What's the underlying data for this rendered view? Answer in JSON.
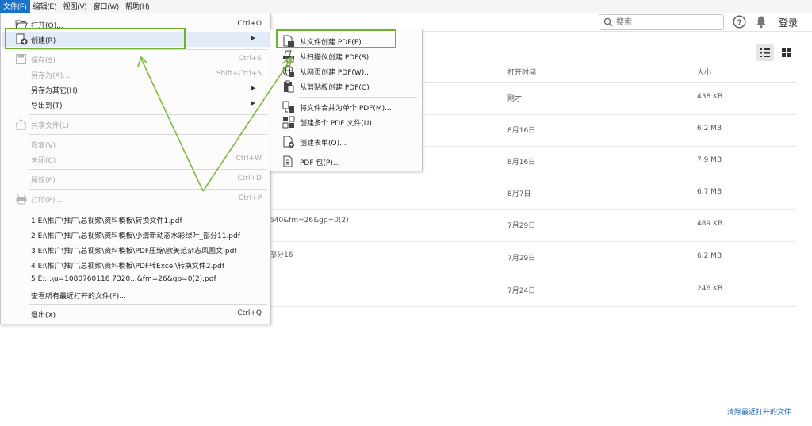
{
  "menubar": [
    {
      "label": "文件(F)",
      "active": true
    },
    {
      "label": "编辑(E)"
    },
    {
      "label": "视图(V)"
    },
    {
      "label": "窗口(W)"
    },
    {
      "label": "帮助(H)"
    }
  ],
  "toolbar": {
    "search_placeholder": "搜索",
    "login_label": "登录"
  },
  "file_menu": {
    "open": {
      "label": "打开(O)...",
      "shortcut": "Ctrl+O"
    },
    "create": {
      "label": "创建(R)"
    },
    "save": {
      "label": "保存(S)",
      "shortcut": "Ctrl+S"
    },
    "save_as": {
      "label": "另存为(A)...",
      "shortcut": "Shift+Ctrl+S"
    },
    "save_as_other": {
      "label": "另存为其它(H)"
    },
    "export_to": {
      "label": "导出到(T)"
    },
    "share": {
      "label": "共享文件(L)"
    },
    "revert": {
      "label": "恢复(V)"
    },
    "close": {
      "label": "关闭(C)",
      "shortcut": "Ctrl+W"
    },
    "properties": {
      "label": "属性(E)...",
      "shortcut": "Ctrl+D"
    },
    "print": {
      "label": "打印(P)...",
      "shortcut": "Ctrl+P"
    },
    "recent_files": [
      "1 E:\\推广\\推广\\总视频\\资料模板\\转换文件1.pdf",
      "2 E:\\推广\\推广\\总视频\\资料模板\\小清新动态水彩绿叶_部分11.pdf",
      "3 E:\\推广\\推广\\总视频\\资料模板\\PDF压缩\\欧美范杂志风图文.pdf",
      "4 E:\\推广\\推广\\总视频\\资料模板\\PDF转Excel\\转换文件2.pdf",
      "5 E:...\\u=1080760116 7320...&fm=26&gp=0(2).pdf"
    ],
    "view_all_recent": {
      "label": "查看所有最近打开的文件(F)..."
    },
    "exit": {
      "label": "退出(X)",
      "shortcut": "Ctrl+Q"
    }
  },
  "create_submenu": {
    "from_file": "从文件创建 PDF(F)...",
    "from_scanner": "从扫描仪创建 PDF(S)",
    "from_web": "从网页创建 PDF(W)...",
    "from_clipboard": "从剪贴板创建 PDF(C)",
    "combine": "将文件合并为单个 PDF(M)...",
    "create_multiple": "创建多个 PDF 文件(U)...",
    "create_form": "创建表单(O)...",
    "pdf_package": "PDF 包(P)..."
  },
  "table": {
    "headers": {
      "opened": "打开时间",
      "size": "大小"
    },
    "rows": [
      {
        "name": "",
        "opened": "刚才",
        "size": "438 KB"
      },
      {
        "name": "",
        "opened": "8月16日",
        "size": "6.2 MB"
      },
      {
        "name": "",
        "opened": "8月16日",
        "size": "7.9 MB"
      },
      {
        "name": "",
        "opened": "8月7日",
        "size": "6.7 MB"
      },
      {
        "name": "640&fm=26&gp=0(2)",
        "opened": "7月29日",
        "size": "489 KB"
      },
      {
        "name": "部分16",
        "opened": "7月29日",
        "size": "6.2 MB"
      },
      {
        "name": "",
        "opened": "7月24日",
        "size": "246 KB"
      }
    ]
  },
  "footer": {
    "clear_recent": "清除最近打开的文件"
  },
  "colors": {
    "accent": "#1a73c8",
    "highlight": "#6cb22a",
    "link": "#1c64b4"
  }
}
